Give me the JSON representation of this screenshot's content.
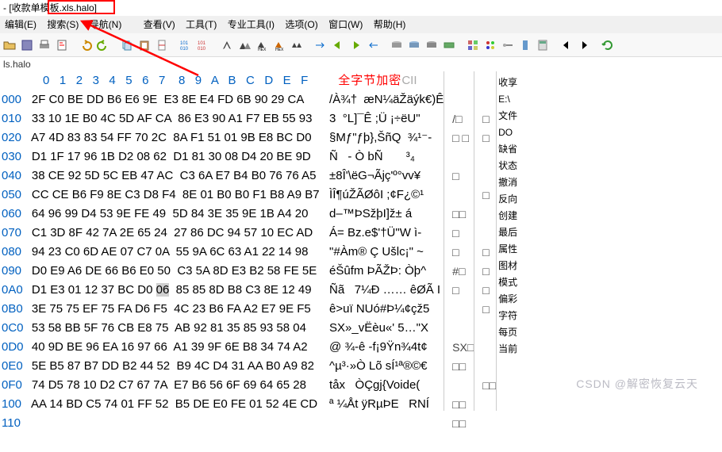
{
  "title": "- [收款单模板.xls.halo]",
  "menu": [
    "编辑(E)",
    "搜索(S)",
    "导航(N)",
    "查看(V)",
    "工具(T)",
    "专业工具(I)",
    "选项(O)",
    "窗口(W)",
    "帮助(H)"
  ],
  "tabname": "ls.halo",
  "hex_header": " 0   1   2   3   4   5   6   7    8   9   A   B   C   D   E   F",
  "ascii_header_red": "全字节加密",
  "ascii_header_gray": "CII",
  "offsets": [
    "000",
    "010",
    "020",
    "030",
    "040",
    "050",
    "060",
    "070",
    "080",
    "090",
    "0A0",
    "0B0",
    "0C0",
    "0D0",
    "0E0",
    "0F0",
    "100",
    "110"
  ],
  "hex_rows": [
    "2F C0 BE DD B6 E6 9E  E3 8E E4 FD 6B 90 29 CA",
    "33 10 1E B0 4C 5D AF CA  86 E3 90 A1 F7 EB 55 93",
    "A7 4D 83 83 54 FF 70 2C  8A F1 51 01 9B E8 BC D0",
    "D1 1F 17 96 1B D2 08 62  D1 81 30 08 D4 20 BE 9D",
    "38 CE 92 5D 5C EB 47 AC  C3 6A E7 B4 B0 76 76 A5",
    "CC CE B6 F9 8E C3 D8 F4  8E 01 B0 B0 F1 B8 A9 B7",
    "64 96 99 D4 53 9E FE 49  5D 84 3E 35 9E 1B A4 20",
    "C1 3D 8F 42 7A 2E 65 24  27 86 DC 94 57 10 EC AD",
    "94 23 C0 6D AE 07 C7 0A  55 9A 6C 63 A1 22 14 98",
    "D0 E9 A6 DE 66 B6 E0 50  C3 5A 8D E3 B2 58 FE 5E",
    "D1 E3 01 12 37 BC D0 06  85 85 8D B8 C3 8E 12 49",
    "3E 75 75 EF 75 FA D6 F5  4C 23 B6 FA A2 E7 9E F5",
    "53 58 BB 5F 76 CB E8 75  AB 92 81 35 85 93 58 04",
    "40 9D BE 96 EA 16 97 66  A1 39 9F 6E B8 34 74 A2",
    "5E B5 87 B7 DD B2 44 52  B9 4C D4 31 AA B0 A9 82",
    "74 D5 78 10 D2 C7 67 7A  E7 B6 56 6F 69 64 65 28",
    "AA 14 BD C5 74 01 FF 52  B5 DE E0 FE 01 52 4E CD",
    "  "
  ],
  "ascii_rows": [
    "/À¾†  æN¼äŽäýk€)Ê",
    "3  °L]¯Ê ;Ü ¡÷ëU\"",
    "§Mƒ\"ƒþ},ŠñQ  ¾¹⁻-",
    "Ñ   - Ò bÑ       ³₄",
    "±8Î'\\ëG¬Ãjç'º°vv¥",
    "ÌÎ¶úŽÃØôI ;¢F¿©¹",
    "d–™ÞSžþI]ž± á",
    "Á= Bz.e$'†Ü\"W ì-",
    "\"#Àm® Ç Ušlc¡\" ~",
    "éŠûfm ÞÃŽÞ: Òþ^",
    "Ñã   7¼Ð …… êØÃ I",
    "ê>uï NUó#Þ¼¢çž5",
    "SX»_vËèu«' 5…\"X",
    "@ ¾-ê -f¡9Ÿn¾4t¢",
    "^µ³·»Ò Lõ sÍ¹ª®©€",
    "tåx   ÒÇgj{Voide(",
    "ª ¼Åt ÿRµÞE   RNÍ",
    ""
  ],
  "preview_rows": [
    "",
    "/□",
    "□ □",
    "",
    "□",
    "",
    "□□",
    "□",
    "□",
    "#□",
    "□",
    "",
    "",
    "SX□",
    "□□",
    "",
    "□□",
    "□□",
    ""
  ],
  "preview_rows2": [
    "",
    "□",
    "□",
    "",
    "",
    "□",
    "",
    "",
    "□",
    "□",
    "□",
    "□",
    "",
    "",
    "",
    "□□",
    "",
    "",
    ""
  ],
  "side_items": [
    "收享",
    "E:\\",
    "文件",
    "DO",
    "缺省",
    "状态",
    "撤消",
    "反向",
    "创建",
    "最后",
    "属性",
    "图材",
    "模式",
    "偏彩",
    "字符",
    "每页",
    "当前"
  ],
  "watermark": "CSDN @解密恢复云天"
}
